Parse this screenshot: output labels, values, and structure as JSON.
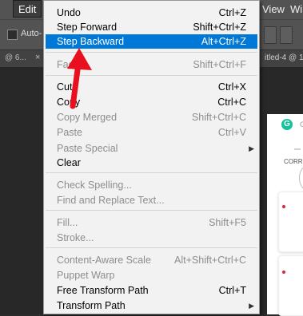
{
  "menubar": {
    "edit": "Edit",
    "view_partial": "View",
    "window_partial": "Wi"
  },
  "options_bar": {
    "auto_select": "Auto-"
  },
  "document_tabs": {
    "left_tab": "@ 6...",
    "close": "×",
    "right_tab": "itled-4 @ 1"
  },
  "grammarly_panel": {
    "logo_letter": "G",
    "header_text": "G",
    "correct_label": "CORR"
  },
  "edit_menu": {
    "items": [
      {
        "label": "Undo",
        "shortcut": "Ctrl+Z",
        "disabled": false
      },
      {
        "label": "Step Forward",
        "shortcut": "Shift+Ctrl+Z",
        "disabled": false
      },
      {
        "label": "Step Backward",
        "shortcut": "Alt+Ctrl+Z",
        "disabled": false,
        "selected": true
      },
      {
        "label": "Fade...",
        "shortcut": "Shift+Ctrl+F",
        "disabled": true
      },
      {
        "label": "Cut",
        "shortcut": "Ctrl+X",
        "disabled": false
      },
      {
        "label": "Copy",
        "shortcut": "Ctrl+C",
        "disabled": false
      },
      {
        "label": "Copy Merged",
        "shortcut": "Shift+Ctrl+C",
        "disabled": true
      },
      {
        "label": "Paste",
        "shortcut": "Ctrl+V",
        "disabled": true
      },
      {
        "label": "Paste Special",
        "shortcut": "",
        "disabled": true,
        "submenu": true
      },
      {
        "label": "Clear",
        "shortcut": "",
        "disabled": false
      },
      {
        "label": "Check Spelling...",
        "shortcut": "",
        "disabled": true
      },
      {
        "label": "Find and Replace Text...",
        "shortcut": "",
        "disabled": true
      },
      {
        "label": "Fill...",
        "shortcut": "Shift+F5",
        "disabled": true
      },
      {
        "label": "Stroke...",
        "shortcut": "",
        "disabled": true
      },
      {
        "label": "Content-Aware Scale",
        "shortcut": "Alt+Shift+Ctrl+C",
        "disabled": true
      },
      {
        "label": "Puppet Warp",
        "shortcut": "",
        "disabled": true
      },
      {
        "label": "Free Transform Path",
        "shortcut": "Ctrl+T",
        "disabled": false
      },
      {
        "label": "Transform Path",
        "shortcut": "",
        "disabled": false,
        "submenu": true
      }
    ],
    "submenu_arrow": "▶"
  },
  "colors": {
    "selection": "#0078d7",
    "annotation_arrow": "#e8101e",
    "disabled_text": "#8d8d8d"
  }
}
